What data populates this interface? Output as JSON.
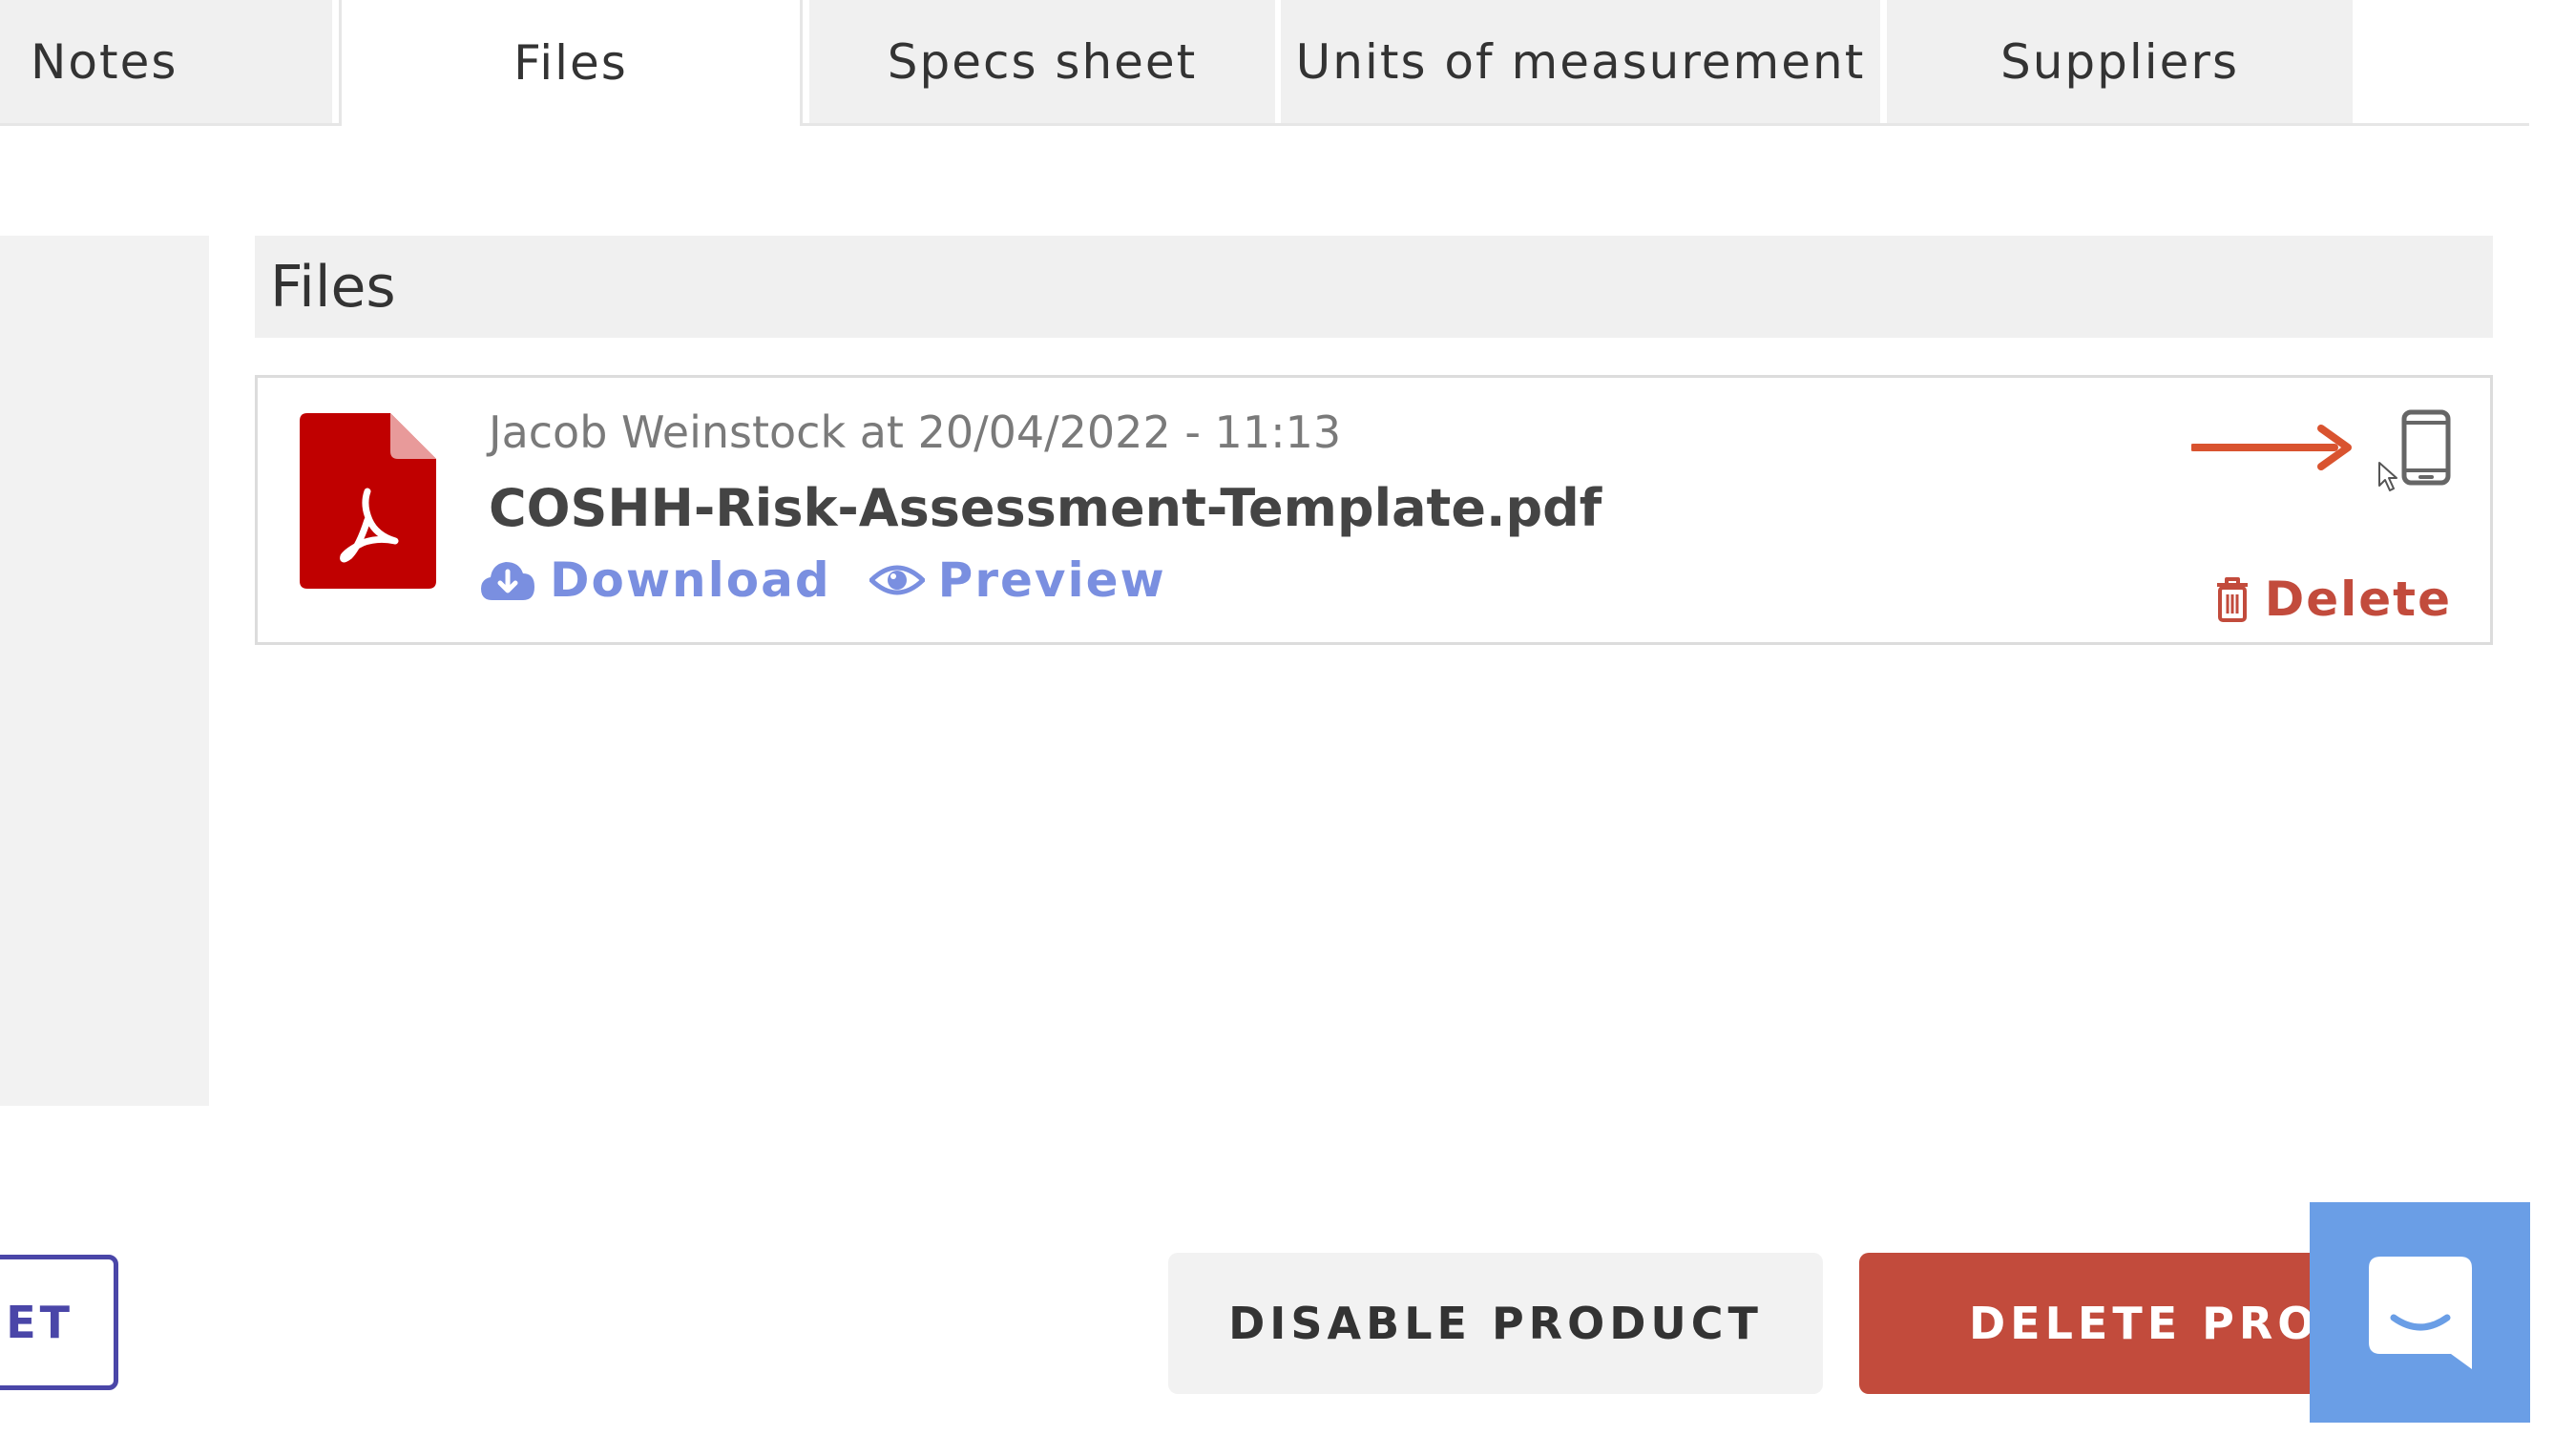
{
  "tabs": {
    "notes": "Notes",
    "files": "Files",
    "specs_sheet": "Specs sheet",
    "units_of_measurement": "Units of measurement",
    "suppliers": "Suppliers",
    "active": "Files"
  },
  "files_section": {
    "title": "Files",
    "file": {
      "uploaded_by": "Jacob Weinstock at 20/04/2022 - 11:13",
      "name": "COSHH-Risk-Assessment-Template.pdf",
      "download_label": "Download",
      "preview_label": "Preview",
      "delete_label": "Delete",
      "type_icon": "pdf-icon"
    }
  },
  "buttons": {
    "partial_left_label": "EET",
    "disable_product": "DISABLE PRODUCT",
    "delete_product": "DELETE PRODU"
  },
  "icons": {
    "download": "cloud-download-icon",
    "preview": "eye-icon",
    "delete": "trash-icon",
    "mobile": "mobile-phone-icon",
    "arrow": "arrow-right-icon",
    "chat": "chat-launcher-icon"
  },
  "colors": {
    "accent_link": "#7a8fe0",
    "danger": "#c24b3c",
    "pdf_red": "#c00000",
    "annotation_arrow": "#d9532f",
    "outline_button": "#4a46a8",
    "chat_launcher": "#6a9ee6",
    "tab_inactive_bg": "#f0f0f0"
  }
}
